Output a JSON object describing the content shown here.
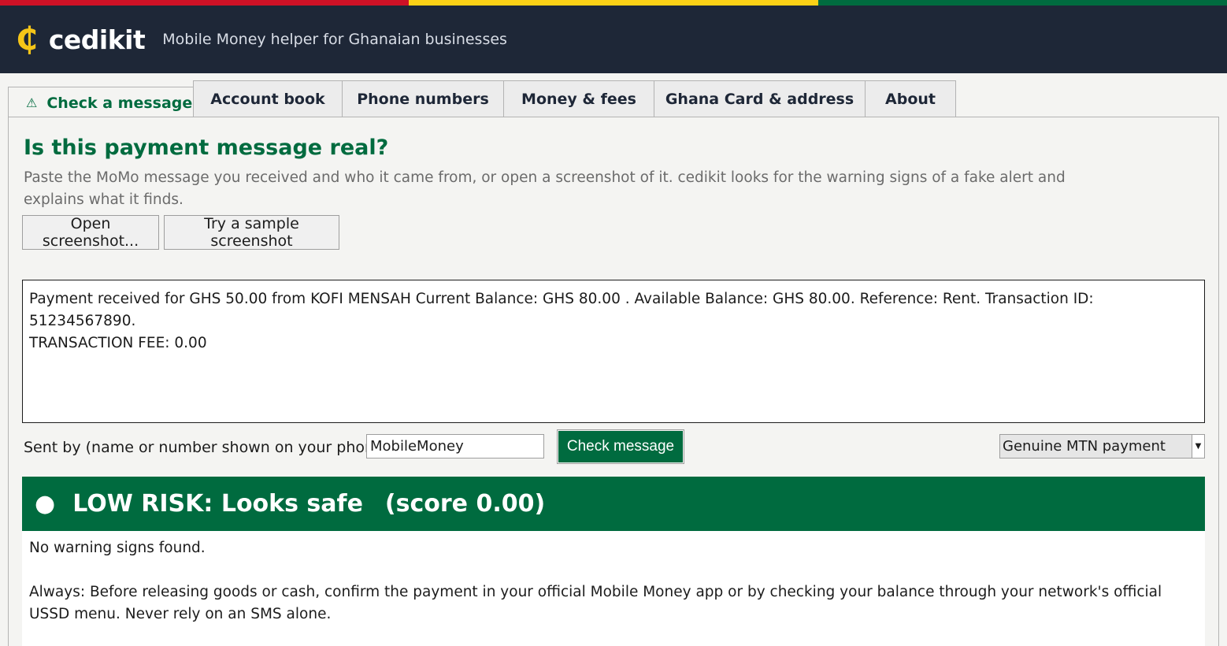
{
  "flag_colors": [
    "#ce1126",
    "#fcd116",
    "#006b3f"
  ],
  "header": {
    "logo_symbol": "₵",
    "brand": "cedikit",
    "tagline": "Mobile Money helper for Ghanaian businesses"
  },
  "tabs": [
    {
      "label": "Check a message",
      "icon": "warning-icon",
      "active": true
    },
    {
      "label": "Account book",
      "active": false
    },
    {
      "label": "Phone numbers",
      "active": false
    },
    {
      "label": "Money & fees",
      "active": false
    },
    {
      "label": "Ghana Card & address",
      "active": false
    },
    {
      "label": "About",
      "active": false
    }
  ],
  "check": {
    "title": "Is this payment message real?",
    "description": "Paste the MoMo message you received and who it came from, or open a screenshot of it. cedikit looks for the warning signs of a fake alert and explains what it finds.",
    "open_button": "Open screenshot...",
    "sample_button": "Try a sample screenshot",
    "message_text": "Payment received for GHS 50.00 from KOFI MENSAH Current Balance: GHS 80.00 . Available Balance: GHS 80.00. Reference: Rent. Transaction ID: 51234567890.\nTRANSACTION FEE: 0.00",
    "sender_label": "Sent by (name or number shown on your phone):",
    "sender_value": "MobileMoney",
    "check_button": "Check message",
    "sample_select": "Genuine MTN payment"
  },
  "result": {
    "dot": "●",
    "risk_label": "LOW RISK: Looks safe",
    "score_text": "(score 0.00)",
    "color": "#006b3f",
    "finding": "No warning signs found.",
    "advice": "Always: Before releasing goods or cash, confirm the payment in your official Mobile Money app or by checking your balance through your network's official USSD menu. Never rely on an SMS alone."
  }
}
